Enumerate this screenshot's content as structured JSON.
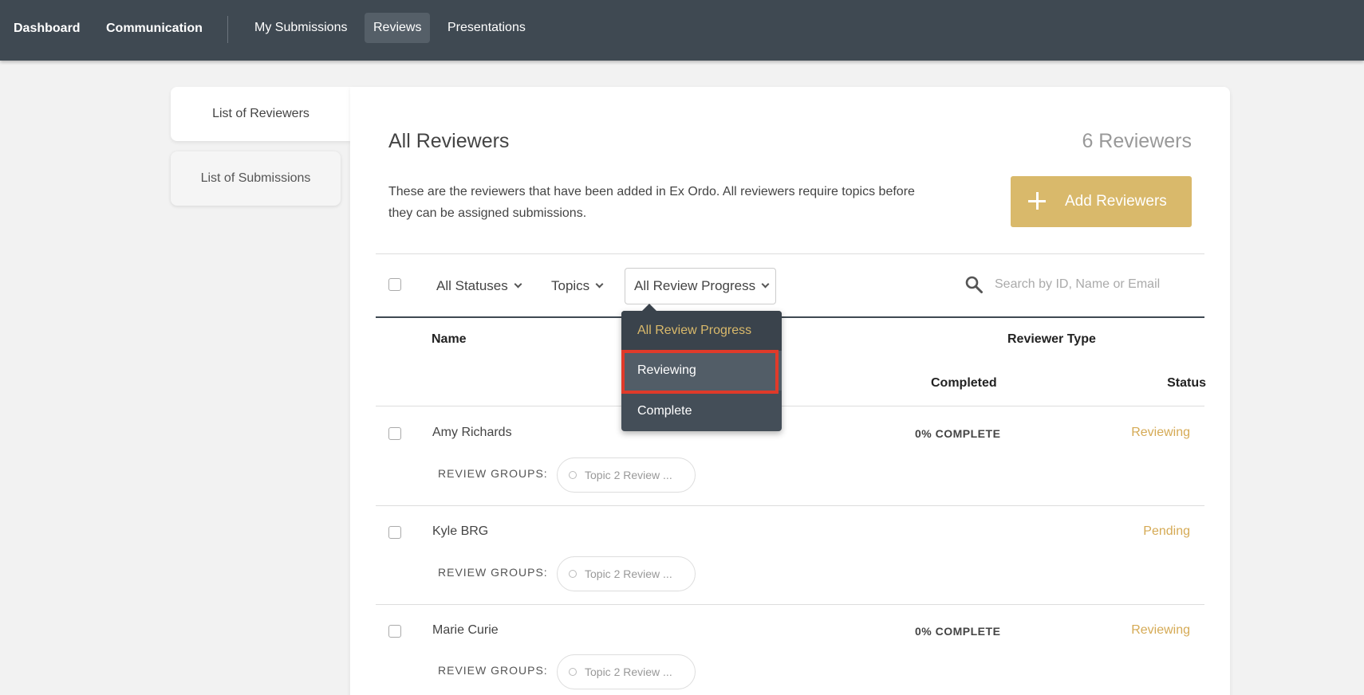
{
  "nav": {
    "dashboard": "Dashboard",
    "communication": "Communication",
    "my_submissions": "My Submissions",
    "reviews": "Reviews",
    "presentations": "Presentations"
  },
  "sidebar": {
    "tabs": [
      {
        "label": "List of Reviewers",
        "active": true
      },
      {
        "label": "List of Submissions",
        "active": false
      }
    ]
  },
  "main": {
    "title": "All Reviewers",
    "count": "6 Reviewers",
    "description": "These are the reviewers that have been added in Ex Ordo. All reviewers require topics before they can be assigned submissions.",
    "add_button": "Add Reviewers"
  },
  "filters": {
    "statuses": "All Statuses",
    "topics": "Topics",
    "review_progress": "All Review Progress",
    "search_placeholder": "Search by ID, Name or Email"
  },
  "columns": {
    "name": "Name",
    "reviewer_type": "Reviewer Type",
    "completed": "Completed",
    "status": "Status"
  },
  "dropdown": {
    "options": [
      "All Review Progress",
      "Reviewing",
      "Complete"
    ],
    "selected": "All Review Progress",
    "highlighted": "Reviewing"
  },
  "reviewers": [
    {
      "name": "Amy Richards",
      "groups_label": "REVIEW GROUPS:",
      "group": "Topic 2 Review ...",
      "completed": "0% COMPLETE",
      "status": "Reviewing"
    },
    {
      "name": "Kyle BRG",
      "groups_label": "REVIEW GROUPS:",
      "group": "Topic 2 Review ...",
      "completed": "",
      "status": "Pending"
    },
    {
      "name": "Marie Curie",
      "groups_label": "REVIEW GROUPS:",
      "group": "Topic 2 Review ...",
      "completed": "0% COMPLETE",
      "status": "Reviewing"
    }
  ],
  "colors": {
    "navbar": "#3f4952",
    "accent": "#d9b96b",
    "status_text": "#d5aa55",
    "highlight": "#e03a2a"
  },
  "icons": {
    "search": "search-icon",
    "add": "plus-icon",
    "chevron": "chevron-down-icon"
  }
}
